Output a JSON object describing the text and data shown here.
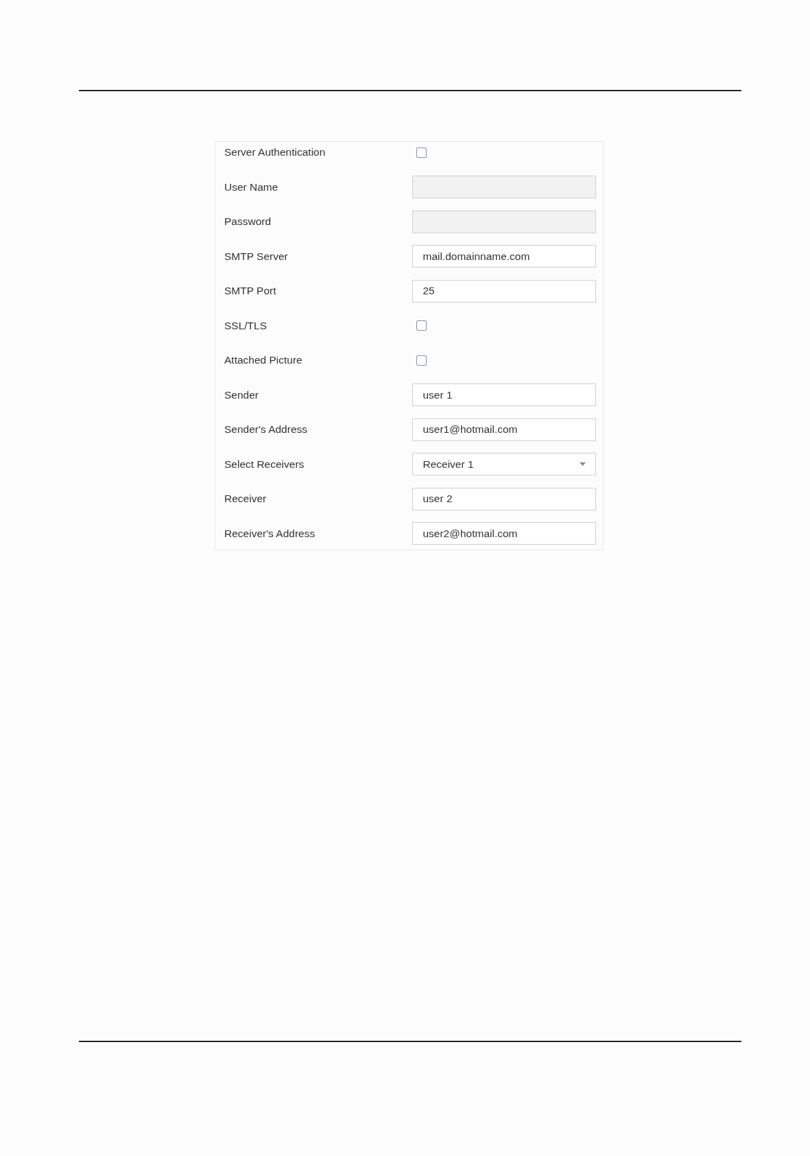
{
  "form": {
    "rows": [
      {
        "label": "Server Authentication",
        "kind": "checkbox",
        "checked": false
      },
      {
        "label": "User Name",
        "kind": "field",
        "disabled": true
      },
      {
        "label": "Password",
        "kind": "field",
        "disabled": true
      },
      {
        "label": "SMTP Server",
        "kind": "field",
        "disabled": false,
        "value": "mail.domainname.com"
      },
      {
        "label": "SMTP Port",
        "kind": "field",
        "disabled": false,
        "value": "25"
      },
      {
        "label": "SSL/TLS",
        "kind": "checkbox",
        "checked": false
      },
      {
        "label": "Attached Picture",
        "kind": "checkbox",
        "checked": false
      },
      {
        "label": "Sender",
        "kind": "field",
        "disabled": false,
        "value": "user 1"
      },
      {
        "label": "Sender's Address",
        "kind": "field",
        "disabled": false,
        "value": "user1@hotmail.com"
      },
      {
        "label": "Select Receivers",
        "kind": "select",
        "value": "Receiver 1"
      },
      {
        "label": "Receiver",
        "kind": "field",
        "disabled": false,
        "value": "user 2"
      },
      {
        "label": "Receiver's Address",
        "kind": "field",
        "disabled": false,
        "value": "user2@hotmail.com"
      }
    ]
  }
}
